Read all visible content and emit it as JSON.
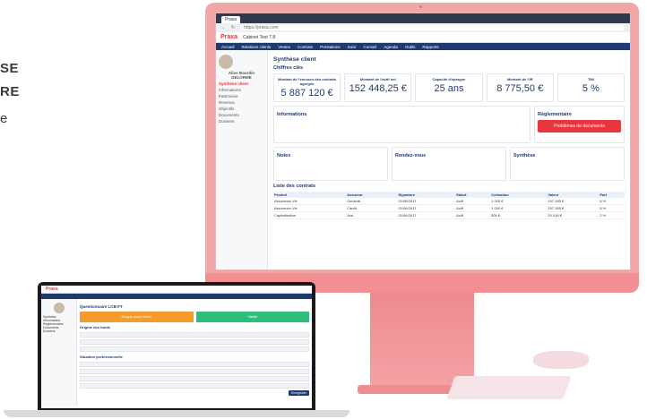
{
  "background_text": [
    "SE",
    "RE",
    "e"
  ],
  "imac": {
    "tab_title": "Praxa",
    "url": "https://praxa.com",
    "app_logo": "Praxa",
    "client_label": "Cabinet Test 7.8",
    "menu": [
      "Accueil",
      "Relations clients",
      "Ventes",
      "Contrats",
      "Prestations",
      "Suivi",
      "Conseil",
      "Agenda",
      "Outils",
      "Rapports"
    ],
    "sidebar": {
      "user_name": "Alice Bourdin DELORME",
      "items": [
        "Synthèse client",
        "Informations",
        "Patrimoine",
        "Revenus",
        "Objectifs",
        "Documents",
        "Dossiers"
      ],
      "active": "Synthèse client"
    },
    "page_title": "Synthèse client",
    "section_kpi": "Chiffres clés",
    "kpis": [
      {
        "label": "Montant de l'encours des contrats agrégés",
        "value": "5 887 120 €"
      },
      {
        "label": "Montant de l'actif net",
        "value": "152 448,25 €"
      },
      {
        "label": "Capacité d'épargne",
        "value": "25 ans"
      },
      {
        "label": "Montant de l'IR",
        "value": "8 775,50 €"
      },
      {
        "label": "TMI",
        "value": "5 %"
      }
    ],
    "section_info": "Informations",
    "section_reg": "Réglementaire",
    "reg_alert": "Problèmes de documents",
    "section_notes": "Notes",
    "section_rdv": "Rendez-vous",
    "section_synth": "Synthèse",
    "section_contracts": "Liste des contrats",
    "table_headers": [
      "Produit",
      "Assureur",
      "Signature",
      "Statut",
      "Cotisation",
      "Valeur",
      "Part"
    ],
    "table_rows": [
      [
        "Assurance Vie",
        "Generali",
        "01/06/2017",
        "Actif",
        "1 000 €",
        "197 185 €",
        "8 %"
      ],
      [
        "Assurance Vie",
        "Cardif",
        "01/06/2017",
        "Actif",
        "1 000 €",
        "197 185 €",
        "8 %"
      ],
      [
        "Capitalisation",
        "Axa",
        "01/06/2017",
        "Actif",
        "500 €",
        "19 018 €",
        "2 %"
      ]
    ]
  },
  "laptop": {
    "app_logo": "Praxa",
    "page_title": "Questionnaire LCB-FT",
    "button_orange": "Risque client élevé",
    "button_green": "Validé",
    "sidebar_items": [
      "Synthèse",
      "Informations",
      "Réglementaire",
      "Documents",
      "Dossiers"
    ],
    "section_one": "Origine des fonds",
    "section_two": "Situation professionnelle",
    "submit": "Enregistrer"
  }
}
